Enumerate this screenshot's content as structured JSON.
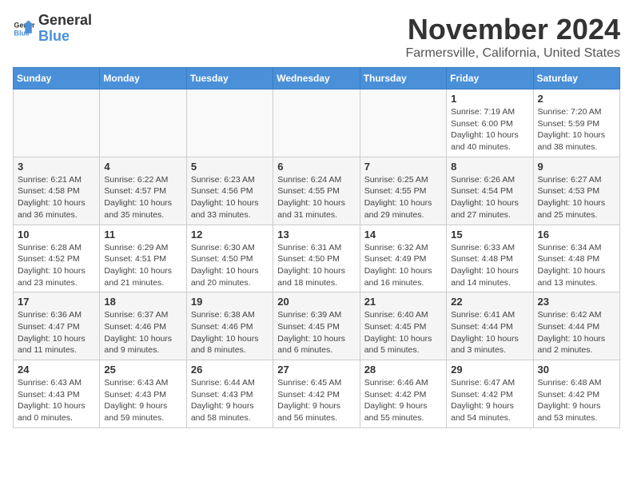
{
  "header": {
    "logo_line1": "General",
    "logo_line2": "Blue",
    "title": "November 2024",
    "subtitle": "Farmersville, California, United States"
  },
  "weekdays": [
    "Sunday",
    "Monday",
    "Tuesday",
    "Wednesday",
    "Thursday",
    "Friday",
    "Saturday"
  ],
  "weeks": [
    [
      {
        "day": "",
        "info": ""
      },
      {
        "day": "",
        "info": ""
      },
      {
        "day": "",
        "info": ""
      },
      {
        "day": "",
        "info": ""
      },
      {
        "day": "",
        "info": ""
      },
      {
        "day": "1",
        "info": "Sunrise: 7:19 AM\nSunset: 6:00 PM\nDaylight: 10 hours\nand 40 minutes."
      },
      {
        "day": "2",
        "info": "Sunrise: 7:20 AM\nSunset: 5:59 PM\nDaylight: 10 hours\nand 38 minutes."
      }
    ],
    [
      {
        "day": "3",
        "info": "Sunrise: 6:21 AM\nSunset: 4:58 PM\nDaylight: 10 hours\nand 36 minutes."
      },
      {
        "day": "4",
        "info": "Sunrise: 6:22 AM\nSunset: 4:57 PM\nDaylight: 10 hours\nand 35 minutes."
      },
      {
        "day": "5",
        "info": "Sunrise: 6:23 AM\nSunset: 4:56 PM\nDaylight: 10 hours\nand 33 minutes."
      },
      {
        "day": "6",
        "info": "Sunrise: 6:24 AM\nSunset: 4:55 PM\nDaylight: 10 hours\nand 31 minutes."
      },
      {
        "day": "7",
        "info": "Sunrise: 6:25 AM\nSunset: 4:55 PM\nDaylight: 10 hours\nand 29 minutes."
      },
      {
        "day": "8",
        "info": "Sunrise: 6:26 AM\nSunset: 4:54 PM\nDaylight: 10 hours\nand 27 minutes."
      },
      {
        "day": "9",
        "info": "Sunrise: 6:27 AM\nSunset: 4:53 PM\nDaylight: 10 hours\nand 25 minutes."
      }
    ],
    [
      {
        "day": "10",
        "info": "Sunrise: 6:28 AM\nSunset: 4:52 PM\nDaylight: 10 hours\nand 23 minutes."
      },
      {
        "day": "11",
        "info": "Sunrise: 6:29 AM\nSunset: 4:51 PM\nDaylight: 10 hours\nand 21 minutes."
      },
      {
        "day": "12",
        "info": "Sunrise: 6:30 AM\nSunset: 4:50 PM\nDaylight: 10 hours\nand 20 minutes."
      },
      {
        "day": "13",
        "info": "Sunrise: 6:31 AM\nSunset: 4:50 PM\nDaylight: 10 hours\nand 18 minutes."
      },
      {
        "day": "14",
        "info": "Sunrise: 6:32 AM\nSunset: 4:49 PM\nDaylight: 10 hours\nand 16 minutes."
      },
      {
        "day": "15",
        "info": "Sunrise: 6:33 AM\nSunset: 4:48 PM\nDaylight: 10 hours\nand 14 minutes."
      },
      {
        "day": "16",
        "info": "Sunrise: 6:34 AM\nSunset: 4:48 PM\nDaylight: 10 hours\nand 13 minutes."
      }
    ],
    [
      {
        "day": "17",
        "info": "Sunrise: 6:36 AM\nSunset: 4:47 PM\nDaylight: 10 hours\nand 11 minutes."
      },
      {
        "day": "18",
        "info": "Sunrise: 6:37 AM\nSunset: 4:46 PM\nDaylight: 10 hours\nand 9 minutes."
      },
      {
        "day": "19",
        "info": "Sunrise: 6:38 AM\nSunset: 4:46 PM\nDaylight: 10 hours\nand 8 minutes."
      },
      {
        "day": "20",
        "info": "Sunrise: 6:39 AM\nSunset: 4:45 PM\nDaylight: 10 hours\nand 6 minutes."
      },
      {
        "day": "21",
        "info": "Sunrise: 6:40 AM\nSunset: 4:45 PM\nDaylight: 10 hours\nand 5 minutes."
      },
      {
        "day": "22",
        "info": "Sunrise: 6:41 AM\nSunset: 4:44 PM\nDaylight: 10 hours\nand 3 minutes."
      },
      {
        "day": "23",
        "info": "Sunrise: 6:42 AM\nSunset: 4:44 PM\nDaylight: 10 hours\nand 2 minutes."
      }
    ],
    [
      {
        "day": "24",
        "info": "Sunrise: 6:43 AM\nSunset: 4:43 PM\nDaylight: 10 hours\nand 0 minutes."
      },
      {
        "day": "25",
        "info": "Sunrise: 6:43 AM\nSunset: 4:43 PM\nDaylight: 9 hours\nand 59 minutes."
      },
      {
        "day": "26",
        "info": "Sunrise: 6:44 AM\nSunset: 4:43 PM\nDaylight: 9 hours\nand 58 minutes."
      },
      {
        "day": "27",
        "info": "Sunrise: 6:45 AM\nSunset: 4:42 PM\nDaylight: 9 hours\nand 56 minutes."
      },
      {
        "day": "28",
        "info": "Sunrise: 6:46 AM\nSunset: 4:42 PM\nDaylight: 9 hours\nand 55 minutes."
      },
      {
        "day": "29",
        "info": "Sunrise: 6:47 AM\nSunset: 4:42 PM\nDaylight: 9 hours\nand 54 minutes."
      },
      {
        "day": "30",
        "info": "Sunrise: 6:48 AM\nSunset: 4:42 PM\nDaylight: 9 hours\nand 53 minutes."
      }
    ]
  ]
}
